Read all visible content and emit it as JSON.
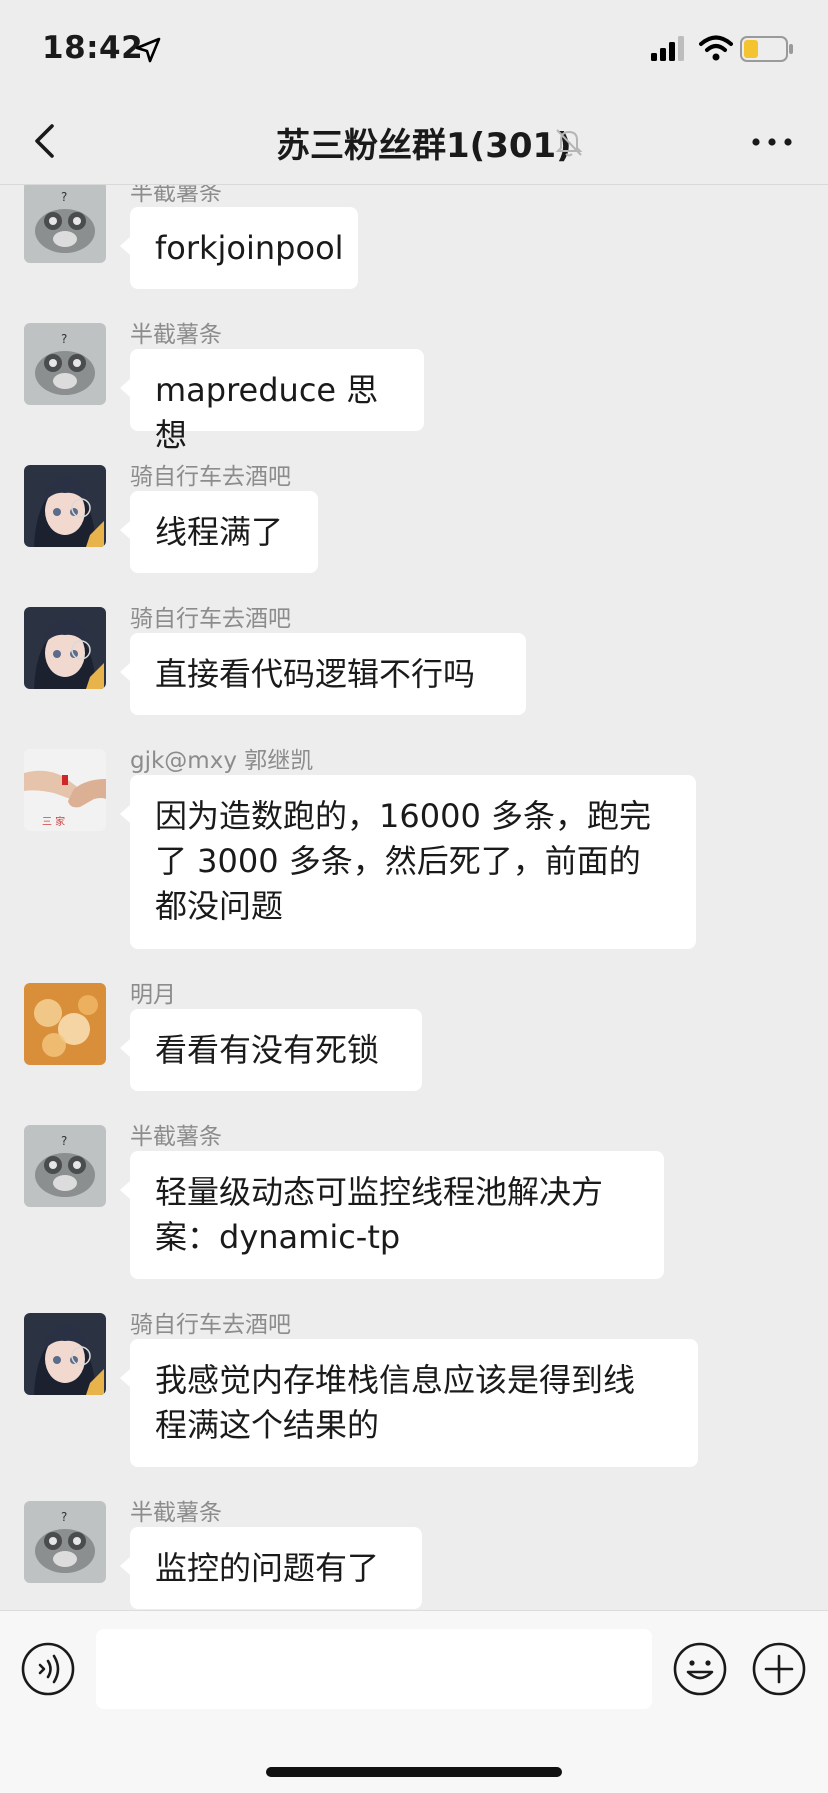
{
  "status_bar": {
    "time": "18:42",
    "icons": [
      "location-arrow-icon",
      "cellular-signal-icon",
      "wifi-icon",
      "battery-low-icon"
    ],
    "battery_color": "#f4c430"
  },
  "header": {
    "title": "苏三粉丝群1(301)",
    "icons": [
      "back-chevron-icon",
      "mute-bell-icon",
      "more-icon"
    ]
  },
  "messages": [
    {
      "sender": "半截薯条",
      "text": "forkjoinpool",
      "avatar": "cat-avatar"
    },
    {
      "sender": "半截薯条",
      "text": "mapreduce 思想",
      "avatar": "cat-avatar"
    },
    {
      "sender": "骑自行车去酒吧",
      "text": "线程满了",
      "avatar": "anime-girl-avatar"
    },
    {
      "sender": "骑自行车去酒吧",
      "text": "直接看代码逻辑不行吗",
      "avatar": "anime-girl-avatar"
    },
    {
      "sender": "gjk@mxy 郭继凯",
      "text": "因为造数跑的，16000 多条，跑完\n了 3000 多条，然后死了，前面的\n都没问题",
      "avatar": "hands-avatar"
    },
    {
      "sender": "明月",
      "text": "看看有没有死锁",
      "avatar": "bokeh-avatar"
    },
    {
      "sender": "半截薯条",
      "text": "轻量级动态可监控线程池解决方\n案：dynamic-tp",
      "avatar": "cat-avatar"
    },
    {
      "sender": "骑自行车去酒吧",
      "text": "我感觉内存堆栈信息应该是得到线\n程满这个结果的",
      "avatar": "anime-girl-avatar"
    },
    {
      "sender": "半截薯条",
      "text": "监控的问题有了",
      "avatar": "cat-avatar"
    }
  ],
  "input_bar": {
    "placeholder": "",
    "icons": [
      "voice-icon",
      "emoji-icon",
      "plus-icon"
    ]
  }
}
